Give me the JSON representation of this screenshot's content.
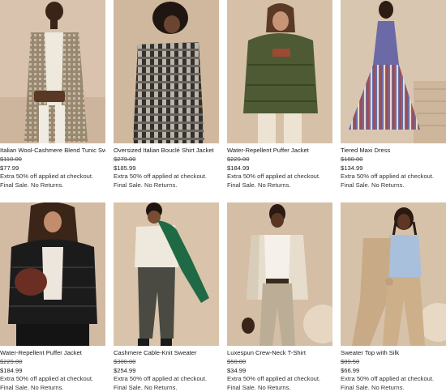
{
  "colors": {
    "text": "#1a1a1a",
    "muted": "#555555",
    "background": "#ffffff"
  },
  "products": [
    {
      "name": "Italian Wool-Cashmere Blend Tunic Sweater",
      "original_price": "$110.00",
      "sale_price": "$77.99",
      "promo": "Extra 50% off applied at checkout.",
      "final_sale": "Final Sale. No Returns."
    },
    {
      "name": "Oversized Italian Bouclé Shirt Jacket",
      "original_price": "$279.00",
      "sale_price": "$185.99",
      "promo": "Extra 50% off applied at checkout.",
      "final_sale": "Final Sale. No Returns."
    },
    {
      "name": "Water-Repellent Puffer Jacket",
      "original_price": "$229.00",
      "sale_price": "$184.99",
      "promo": "Extra 50% off applied at checkout.",
      "final_sale": "Final Sale. No Returns."
    },
    {
      "name": "Tiered Maxi Dress",
      "original_price": "$180.00",
      "sale_price": "$134.99",
      "promo": "Extra 50% off applied at checkout.",
      "final_sale": "Final Sale. No Returns."
    },
    {
      "name": "Water-Repellent Puffer Jacket",
      "original_price": "$229.00",
      "sale_price": "$184.99",
      "promo": "Extra 50% off applied at checkout.",
      "final_sale": "Final Sale. No Returns."
    },
    {
      "name": "Cashmere Cable-Knit Sweater",
      "original_price": "$300.00",
      "sale_price": "$254.99",
      "promo": "Extra 50% off applied at checkout.",
      "final_sale": "Final Sale. No Returns."
    },
    {
      "name": "Luxespun Crew-Neck T-Shirt",
      "original_price": "$50.00",
      "sale_price": "$34.99",
      "promo": "Extra 50% off applied at checkout.",
      "final_sale": "Final Sale. No Returns."
    },
    {
      "name": "Sweater Top with Silk",
      "original_price": "$89.50",
      "sale_price": "$66.99",
      "promo": "Extra 50% off applied at checkout.",
      "final_sale": "Final Sale. No Returns."
    }
  ]
}
